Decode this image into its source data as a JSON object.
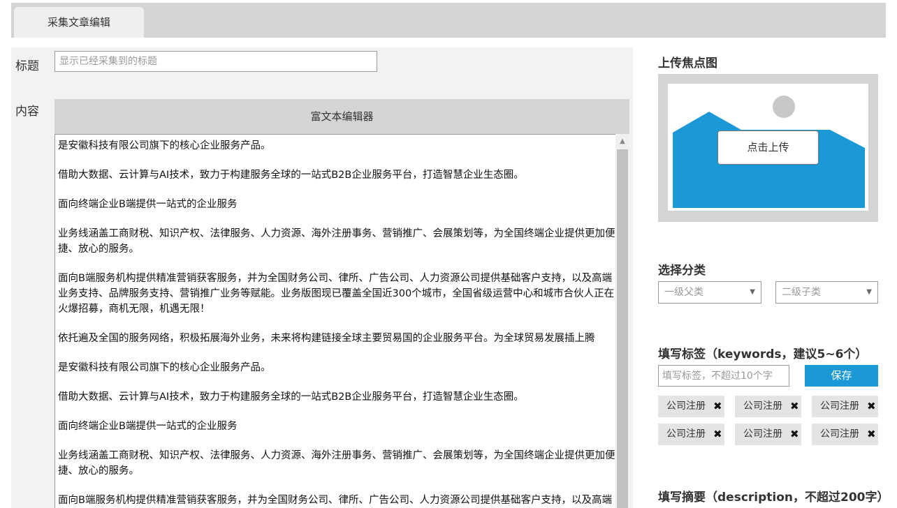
{
  "tab": {
    "label": "采集文章编辑"
  },
  "form": {
    "title_label": "标题",
    "title_placeholder": "显示已经采集到的标题",
    "content_label": "内容"
  },
  "editor": {
    "header": "富文本编辑器",
    "paragraphs": [
      "是安徽科技有限公司旗下的核心企业服务产品。",
      "借助大数据、云计算与AI技术，致力于构建服务全球的一站式B2B企业服务平台，打造智慧企业生态圈。",
      "面向终端企业B端提供一站式的企业服务",
      "业务线涵盖工商财税、知识产权、法律服务、人力资源、海外注册事务、营销推广、会展策划等，为全国终端企业提供更加便捷、放心的服务。",
      "面向B端服务机构提供精准营销获客服务，并为全国财务公司、律所、广告公司、人力资源公司提供基础客户支持，以及高端业务支持、品牌服务支持、营销推广业务等赋能。业务版图现已覆盖全国近300个城市，全国省级运营中心和城市合伙人正在火爆招募，商机无限，机遇无限！",
      "依托遍及全国的服务网络，积极拓展海外业务，未来将构建链接全球主要贸易国的企业服务平台。为全球贸易发展插上腾",
      "是安徽科技有限公司旗下的核心企业服务产品。",
      "借助大数据、云计算与AI技术，致力于构建服务全球的一站式B2B企业服务平台，打造智慧企业生态圈。",
      "面向终端企业B端提供一站式的企业服务",
      "业务线涵盖工商财税、知识产权、法律服务、人力资源、海外注册事务、营销推广、会展策划等，为全国终端企业提供更加便捷、放心的服务。",
      "面向B端服务机构提供精准营销获客服务，并为全国财务公司、律所、广告公司、人力资源公司提供基础客户支持，以及高端业务支持、品牌服务支持、营销推广业务等赋能。"
    ]
  },
  "sidebar": {
    "upload_heading": "上传焦点图",
    "upload_button": "点击上传",
    "category_heading": "选择分类",
    "category_primary": "一级父类",
    "category_secondary": "二级子类",
    "tags_heading": "填写标签（keywords，建议5~6个）",
    "tag_placeholder": "填写标签，不超过10个字",
    "save_button": "保存",
    "tags": [
      "公司注册",
      "公司注册",
      "公司注册",
      "公司注册",
      "公司注册",
      "公司注册"
    ],
    "summary_heading": "填写摘要（description，不超过200字）"
  },
  "colors": {
    "accent": "#1b98d6",
    "panel": "#d4d4d4"
  }
}
